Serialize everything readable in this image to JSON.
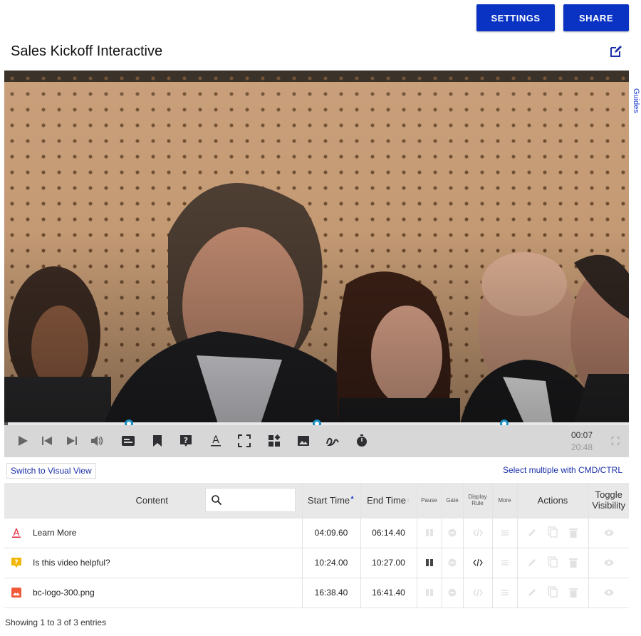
{
  "header": {
    "settings_label": "SETTINGS",
    "share_label": "SHARE",
    "title": "Sales Kickoff Interactive",
    "guides_label": "Guides"
  },
  "player": {
    "progress": 0.0056,
    "cue_points_seconds": [
      249.6,
      624,
      998.4
    ],
    "current_time": "00:07",
    "duration": "20:48",
    "controls": [
      "play-icon",
      "skip-back-icon",
      "skip-forward-icon",
      "volume-icon",
      "caption-icon",
      "bookmark-icon",
      "question-icon",
      "text-icon",
      "hotspot-icon",
      "gallery-icon",
      "image-icon",
      "scribble-icon",
      "timer-icon",
      "fullscreen-icon"
    ]
  },
  "toolbar": {
    "switch_view_label": "Switch to Visual View",
    "select_hint": "Select multiple with CMD/CTRL"
  },
  "table": {
    "headers": {
      "content": "Content",
      "start_time": "Start Time",
      "end_time": "End Time",
      "pause": "Pause",
      "gate": "Gate",
      "display_rule_line1": "Display",
      "display_rule_line2": "Rule",
      "more": "More",
      "actions": "Actions",
      "toggle_line1": "Toggle",
      "toggle_line2": "Visibility"
    },
    "search_placeholder": "",
    "rows": [
      {
        "type_icon": "text-annotation-icon",
        "icon_color": "#e0233a",
        "content": "Learn More",
        "start": "04:09.60",
        "end": "06:14.40",
        "pause_active": false,
        "rule_active": false
      },
      {
        "type_icon": "question-icon",
        "icon_color": "#f2b705",
        "content": "Is this video helpful?",
        "start": "10:24.00",
        "end": "10:27.00",
        "pause_active": true,
        "rule_active": true
      },
      {
        "type_icon": "image-icon",
        "icon_color": "#f05a3a",
        "content": "bc-logo-300.png",
        "start": "16:38.40",
        "end": "16:41.40",
        "pause_active": false,
        "rule_active": false
      }
    ]
  },
  "footer": {
    "entries_info": "Showing 1 to 3 of 3 entries"
  },
  "colors": {
    "primary": "#0a33c4",
    "cue_marker": "#1b8ec2",
    "link": "#1a2fa8"
  }
}
